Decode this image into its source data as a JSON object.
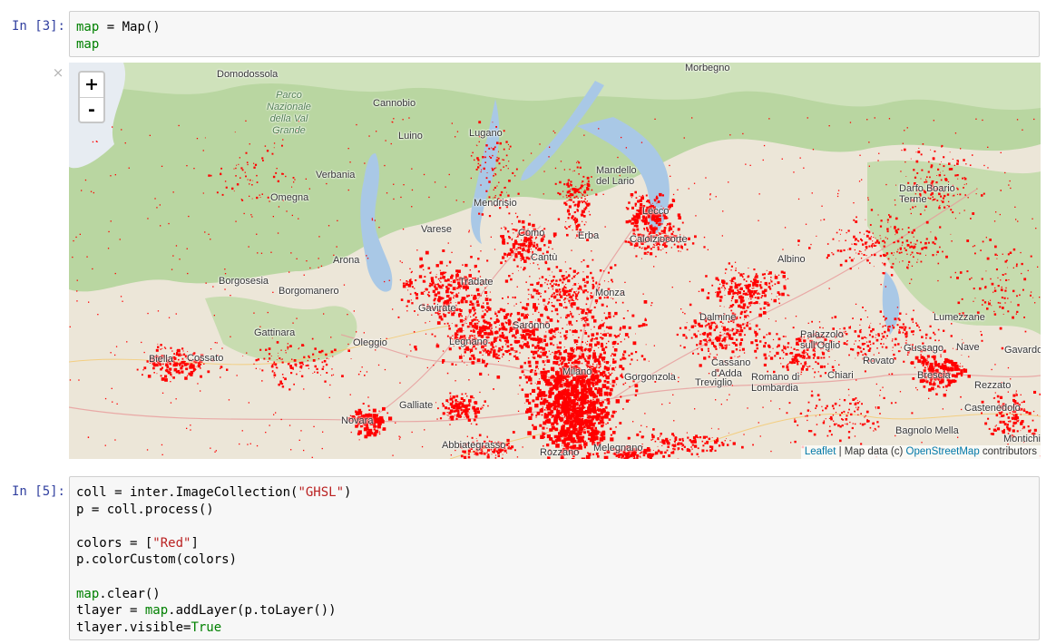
{
  "cells": [
    {
      "prompt": "In [3]:",
      "lines": [
        [
          {
            "t": "map",
            "c": "var"
          },
          {
            "t": " = Map()",
            "c": ""
          }
        ],
        [
          {
            "t": "map",
            "c": "var"
          }
        ]
      ]
    },
    {
      "prompt": "In [5]:",
      "lines": [
        [
          {
            "t": "coll = inter.ImageCollection(",
            "c": ""
          },
          {
            "t": "\"GHSL\"",
            "c": "str"
          },
          {
            "t": ")",
            "c": ""
          }
        ],
        [
          {
            "t": "p = coll.process()",
            "c": ""
          }
        ],
        [],
        [
          {
            "t": "colors = [",
            "c": ""
          },
          {
            "t": "\"Red\"",
            "c": "str"
          },
          {
            "t": "]",
            "c": ""
          }
        ],
        [
          {
            "t": "p.colorCustom(colors)",
            "c": ""
          }
        ],
        [],
        [
          {
            "t": "map",
            "c": "var"
          },
          {
            "t": ".clear()",
            "c": ""
          }
        ],
        [
          {
            "t": "tlayer = ",
            "c": ""
          },
          {
            "t": "map",
            "c": "var"
          },
          {
            "t": ".addLayer(p.toLayer())",
            "c": ""
          }
        ],
        [
          {
            "t": "tlayer.visible=",
            "c": ""
          },
          {
            "t": "True",
            "c": "kw"
          }
        ]
      ]
    }
  ],
  "output_close": "×",
  "map": {
    "zoom_in": "+",
    "zoom_out": "-",
    "attribution": {
      "leaflet": "Leaflet",
      "sep": " | Map data (c) ",
      "osm": "OpenStreetMap",
      "suffix": " contributors"
    },
    "overlay_color": "#ff0000",
    "places": [
      {
        "name": "Domodossola"
      },
      {
        "name": "Parco\nNazionale\ndella Val\nGrande"
      },
      {
        "name": "Cannobio"
      },
      {
        "name": "Morbegno"
      },
      {
        "name": "Luino"
      },
      {
        "name": "Lugano"
      },
      {
        "name": "Verbania"
      },
      {
        "name": "Mandello\ndel Lario"
      },
      {
        "name": "Omegna"
      },
      {
        "name": "Mendrisio"
      },
      {
        "name": "Lecco"
      },
      {
        "name": "Darfo Boario\nTerme"
      },
      {
        "name": "Varese"
      },
      {
        "name": "Como"
      },
      {
        "name": "Erba"
      },
      {
        "name": "Calolziocorte"
      },
      {
        "name": "Arona"
      },
      {
        "name": "Cantù"
      },
      {
        "name": "Albino"
      },
      {
        "name": "Borgosesia"
      },
      {
        "name": "Borgomanero"
      },
      {
        "name": "Saronno"
      },
      {
        "name": "Monza"
      },
      {
        "name": "Dalmine"
      },
      {
        "name": "Gavirate"
      },
      {
        "name": "Tradate"
      },
      {
        "name": "Legnano"
      },
      {
        "name": "Palazzolo\nsull'Oglio"
      },
      {
        "name": "Rovato"
      },
      {
        "name": "Lumezzane"
      },
      {
        "name": "Gattinara"
      },
      {
        "name": "Oleggio"
      },
      {
        "name": "Cassano\nd'Adda"
      },
      {
        "name": "Gussago"
      },
      {
        "name": "Nave"
      },
      {
        "name": "Gavardo"
      },
      {
        "name": "Biella"
      },
      {
        "name": "Cossato"
      },
      {
        "name": "Gorgonzola"
      },
      {
        "name": "Treviglio"
      },
      {
        "name": "Romano di\nLombardia"
      },
      {
        "name": "Chiari"
      },
      {
        "name": "Brescia"
      },
      {
        "name": "Rezzato"
      },
      {
        "name": "Galliate"
      },
      {
        "name": "Castenedolo"
      },
      {
        "name": "Novara"
      },
      {
        "name": "Bagnolo Mella"
      },
      {
        "name": "Montichiari"
      },
      {
        "name": "Abbiategrasso"
      },
      {
        "name": "Rozzano"
      },
      {
        "name": "Melegnano"
      },
      {
        "name": "Milano"
      }
    ]
  }
}
